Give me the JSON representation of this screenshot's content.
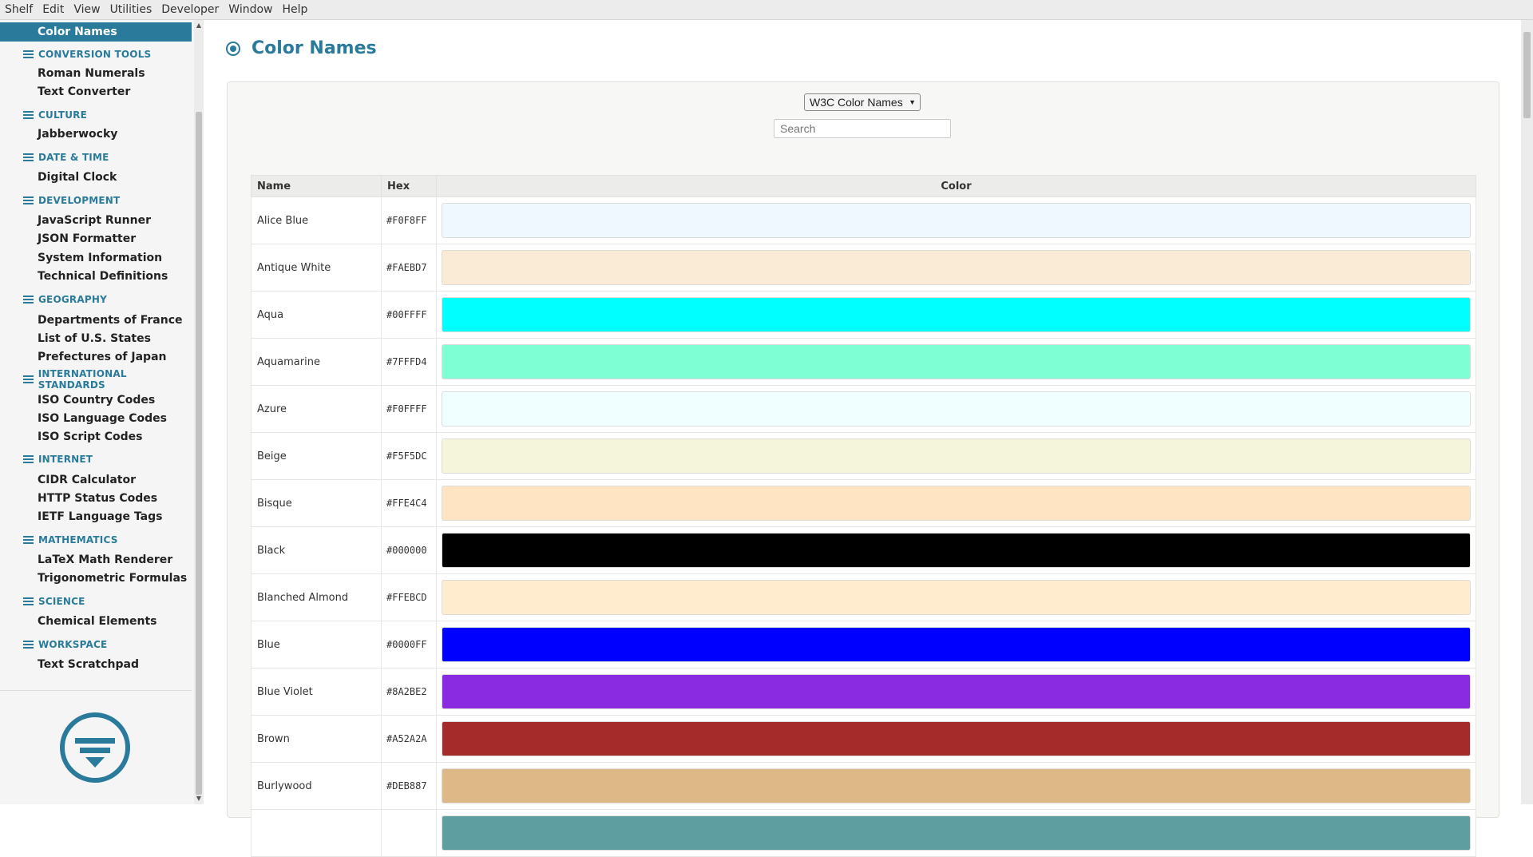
{
  "menubar": {
    "items": [
      "Shelf",
      "Edit",
      "View",
      "Utilities",
      "Developer",
      "Window",
      "Help"
    ]
  },
  "sidebar": {
    "active": "Color Names",
    "sections": [
      {
        "category": "CONVERSION TOOLS",
        "items": [
          "Roman Numerals",
          "Text Converter"
        ]
      },
      {
        "category": "CULTURE",
        "items": [
          "Jabberwocky"
        ]
      },
      {
        "category": "DATE & TIME",
        "items": [
          "Digital Clock"
        ]
      },
      {
        "category": "DEVELOPMENT",
        "items": [
          "JavaScript Runner",
          "JSON Formatter",
          "System Information",
          "Technical Definitions"
        ]
      },
      {
        "category": "GEOGRAPHY",
        "items": [
          "Departments of France",
          "List of U.S. States",
          "Prefectures of Japan"
        ]
      },
      {
        "category": "INTERNATIONAL STANDARDS",
        "items": [
          "ISO Country Codes",
          "ISO Language Codes",
          "ISO Script Codes"
        ]
      },
      {
        "category": "INTERNET",
        "items": [
          "CIDR Calculator",
          "HTTP Status Codes",
          "IETF Language Tags"
        ]
      },
      {
        "category": "MATHEMATICS",
        "items": [
          "LaTeX Math Renderer",
          "Trigonometric Formulas"
        ]
      },
      {
        "category": "SCIENCE",
        "items": [
          "Chemical Elements"
        ]
      },
      {
        "category": "WORKSPACE",
        "items": [
          "Text Scratchpad"
        ]
      }
    ]
  },
  "main": {
    "title": "Color Names",
    "set_select": {
      "value": "W3C Color Names"
    },
    "search": {
      "placeholder": "Search"
    },
    "table": {
      "headers": [
        "Name",
        "Hex",
        "Color"
      ],
      "rows": [
        {
          "name": "Alice Blue",
          "hex": "#F0F8FF"
        },
        {
          "name": "Antique White",
          "hex": "#FAEBD7"
        },
        {
          "name": "Aqua",
          "hex": "#00FFFF"
        },
        {
          "name": "Aquamarine",
          "hex": "#7FFFD4"
        },
        {
          "name": "Azure",
          "hex": "#F0FFFF"
        },
        {
          "name": "Beige",
          "hex": "#F5F5DC"
        },
        {
          "name": "Bisque",
          "hex": "#FFE4C4"
        },
        {
          "name": "Black",
          "hex": "#000000"
        },
        {
          "name": "Blanched Almond",
          "hex": "#FFEBCD"
        },
        {
          "name": "Blue",
          "hex": "#0000FF"
        },
        {
          "name": "Blue Violet",
          "hex": "#8A2BE2"
        },
        {
          "name": "Brown",
          "hex": "#A52A2A"
        },
        {
          "name": "Burlywood",
          "hex": "#DEB887"
        }
      ],
      "partial_row_color": "#5F9EA0"
    }
  },
  "colors": {
    "accent": "#2a7b9b"
  }
}
